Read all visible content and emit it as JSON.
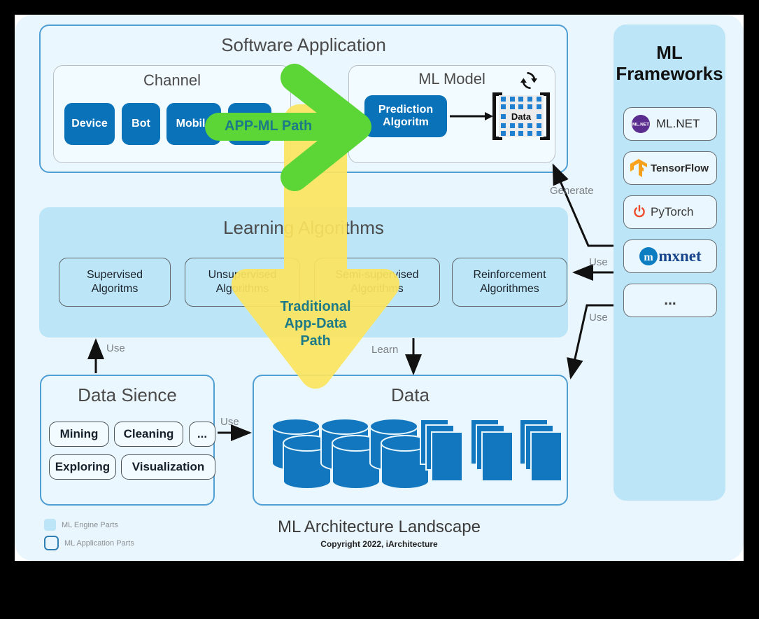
{
  "colors": {
    "app_border": "#4f9ed4",
    "engine_band": "#bce6f7",
    "accent_blue": "#0a72b9",
    "green_path": "#5cd636",
    "yellow_path": "#fbe55f",
    "path_text": "#1d7a86",
    "canvas": "#eaf6fd"
  },
  "software_application": {
    "title": "Software Application",
    "channel": {
      "title": "Channel",
      "items": [
        "Device",
        "Bot",
        "Mobile",
        ""
      ]
    },
    "ml_model": {
      "title": "ML Model",
      "refresh_icon": "refresh-icon",
      "prediction": "Prediction\nAlgoritm",
      "prediction_line1": "Prediction",
      "prediction_line2": "Algoritm",
      "data_label": "Data"
    }
  },
  "learning_algorithms": {
    "title": "Learning Algorithms",
    "items": [
      {
        "line1": "Supervised",
        "line2": "Algoritms"
      },
      {
        "line1": "Unsupervised",
        "line2": "Algorithms"
      },
      {
        "line1": "Semi-supervised",
        "line2": "Algorithms"
      },
      {
        "line1": "Reinforcement",
        "line2": "Algorithmes"
      }
    ]
  },
  "data_science": {
    "title": "Data Sience",
    "items": [
      "Mining",
      "Cleaning",
      "...",
      "Exploring",
      "Visualization"
    ]
  },
  "data": {
    "title": "Data",
    "cylinders": 3,
    "document_stacks": 3
  },
  "ml_frameworks": {
    "title_line1": "ML",
    "title_line2": "Frameworks",
    "items": [
      {
        "label": "ML.NET",
        "icon": "mlnet-logo-icon"
      },
      {
        "label": "TensorFlow",
        "icon": "tensorflow-logo-icon"
      },
      {
        "label": "PyTorch",
        "icon": "pytorch-logo-icon"
      },
      {
        "label": "mxnet",
        "icon": "mxnet-logo-icon"
      },
      {
        "label": "...",
        "icon": "ellipsis-icon"
      }
    ]
  },
  "paths": {
    "green_line1": "APP-ML Path",
    "yellow_line1": "Traditional",
    "yellow_line2": "App-Data",
    "yellow_line3": "Path"
  },
  "edge_labels": {
    "generate": "Generate",
    "use_frameworks_algos": "Use",
    "use_frameworks_data": "Use",
    "use_ds_algos": "Use",
    "use_ds_data": "Use",
    "learn": "Learn"
  },
  "legend": [
    {
      "type": "fill",
      "label": "ML Engine Parts"
    },
    {
      "type": "outline",
      "label": "ML Application Parts"
    }
  ],
  "footer": {
    "title": "ML Architecture Landscape",
    "copyright": "Copyright 2022, iArchitecture"
  }
}
